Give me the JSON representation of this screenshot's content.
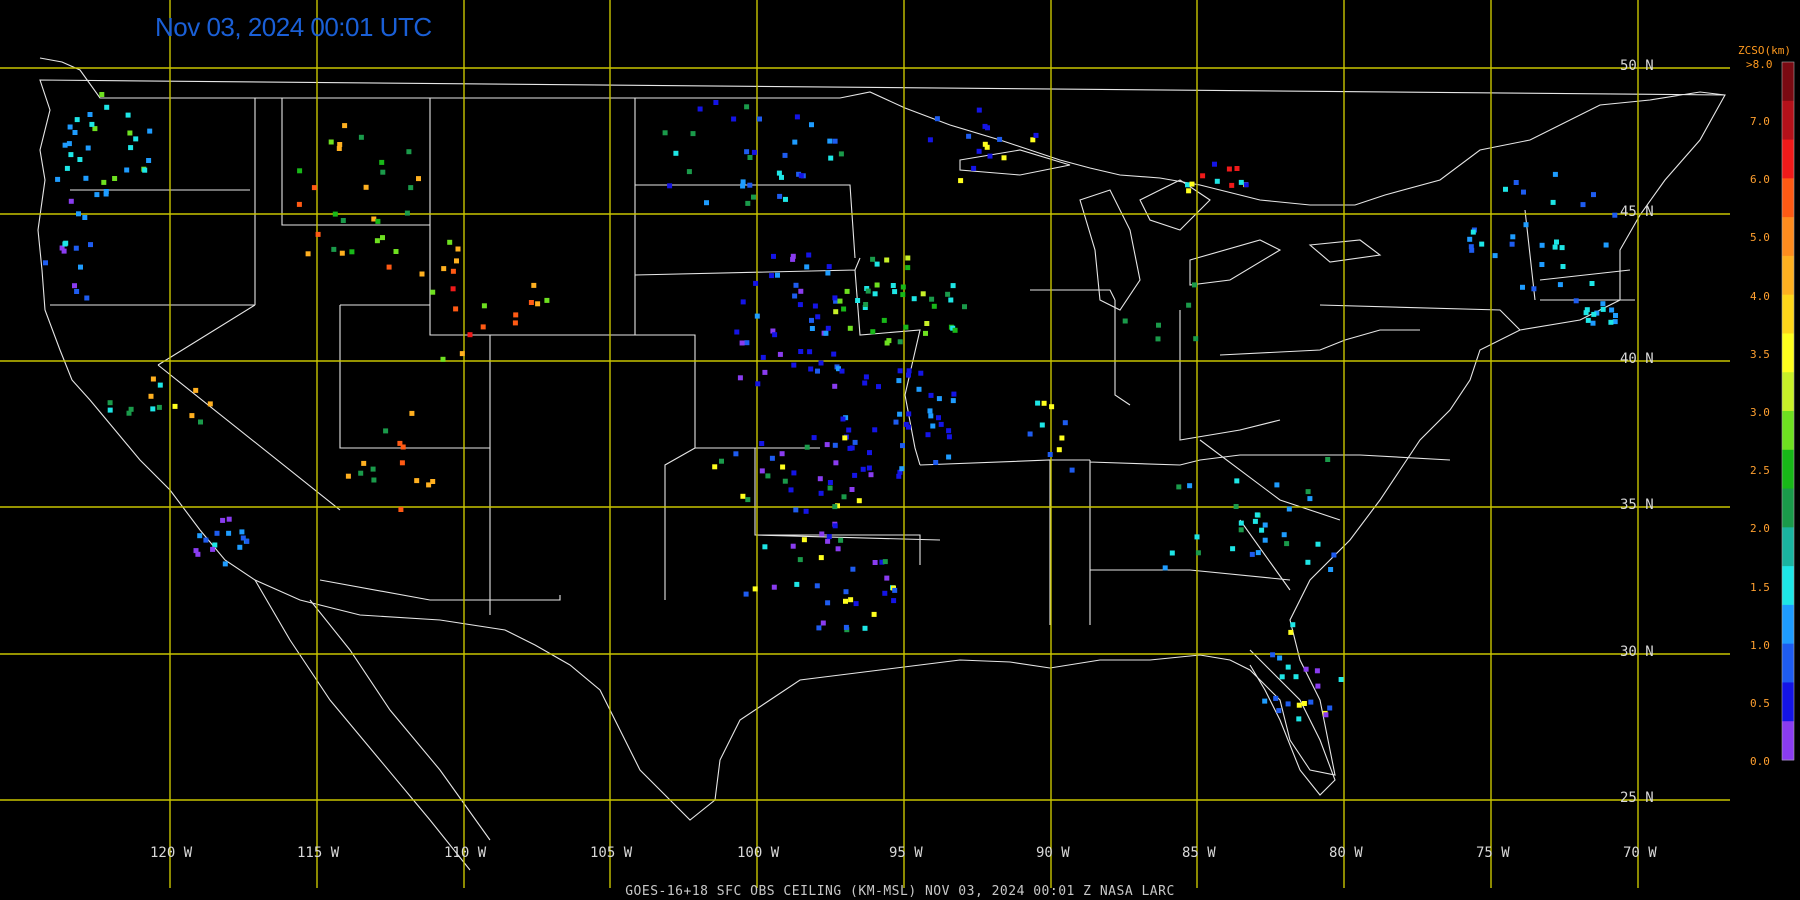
{
  "map": {
    "timestamp": "Nov 03, 2024 00:01 UTC",
    "footer_text": "GOES-16+18  SFC OBS CEILING (KM-MSL)   NOV 03, 2024 00:01 Z   NASA LARC",
    "lat_labels": [
      "50 N",
      "45 N",
      "40 N",
      "35 N",
      "30 N",
      "25 N"
    ],
    "lon_labels": [
      "120 W",
      "115 W",
      "110 W",
      "105 W",
      "100 W",
      "95 W",
      "90 W",
      "85 W",
      "80 W",
      "75 W",
      "70 W"
    ],
    "colors": {
      "grid": "#c8c400",
      "borders": "#e6e6e6",
      "background": "#000000",
      "timestamp": "#1a5fd6"
    }
  },
  "legend": {
    "title": "ZCSO(km)",
    "top_label": ">8.0",
    "ticks": [
      "7.0",
      "6.0",
      "5.0",
      "4.0",
      "3.5",
      "3.0",
      "2.5",
      "2.0",
      "1.5",
      "1.0",
      "0.5",
      "0.0"
    ],
    "colors": [
      "#7a0a12",
      "#b4111a",
      "#f01a1a",
      "#ff5a14",
      "#ff8c1e",
      "#ffb020",
      "#ffd61a",
      "#ffff1e",
      "#c8f028",
      "#6ee020",
      "#18b818",
      "#1a9a4a",
      "#1ab4a0",
      "#1ee6e6",
      "#1e9cff",
      "#1e5cf0",
      "#1414e6",
      "#8a3cf0"
    ]
  }
}
